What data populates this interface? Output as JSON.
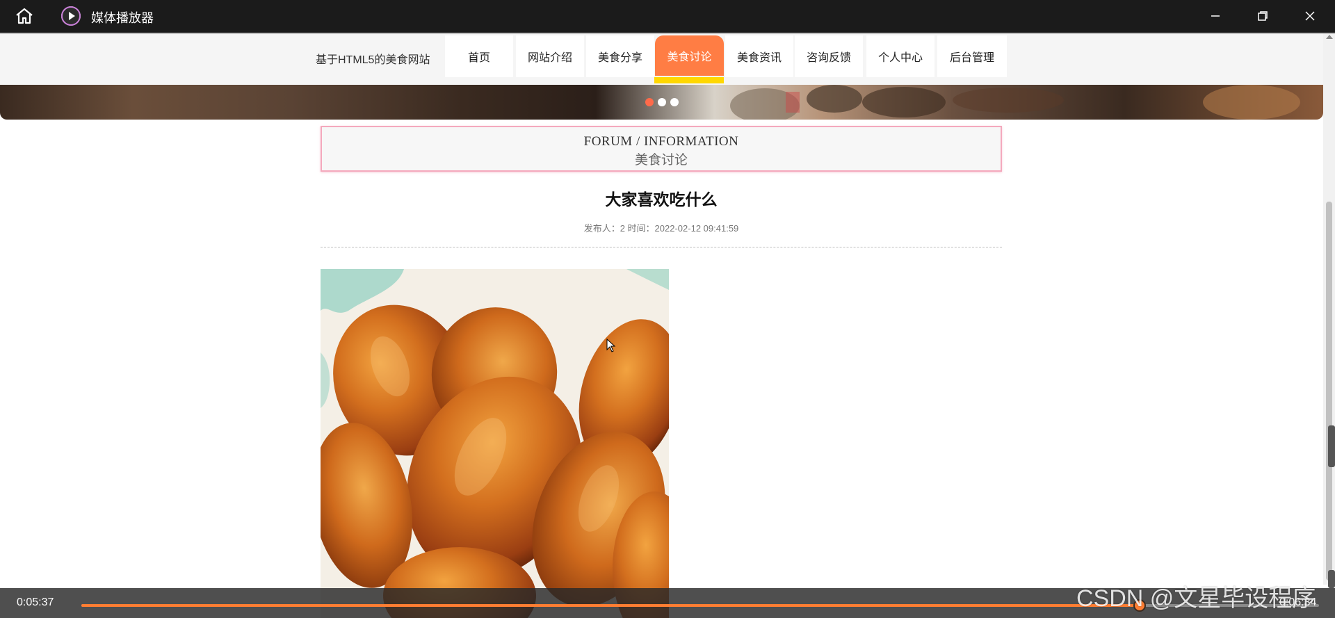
{
  "window": {
    "title": "媒体播放器"
  },
  "navbar": {
    "site_title": "基于HTML5的美食网站",
    "items": [
      {
        "label": "首页"
      },
      {
        "label": "网站介绍"
      },
      {
        "label": "美食分享"
      },
      {
        "label": "美食讨论",
        "active": true
      },
      {
        "label": "美食资讯"
      },
      {
        "label": "咨询反馈"
      },
      {
        "label": "个人中心"
      },
      {
        "label": "后台管理"
      }
    ]
  },
  "carousel": {
    "dots": 3,
    "active_dot": 0
  },
  "forum": {
    "heading_en": "FORUM / INFORMATION",
    "heading_cn": "美食讨论"
  },
  "post": {
    "title": "大家喜欢吃什么",
    "meta": "发布人：2 时间：2022-02-12 09:41:59"
  },
  "player": {
    "current_time": "0:05:37",
    "total_time": "0:06:34",
    "progress": 0.855
  },
  "watermark": "CSDN @文星毕设程序",
  "colors": {
    "accent": "#ff7d44",
    "active_underline": "#ffd700",
    "progress": "#ff7d32",
    "titlebar": "#1b1b1b"
  }
}
